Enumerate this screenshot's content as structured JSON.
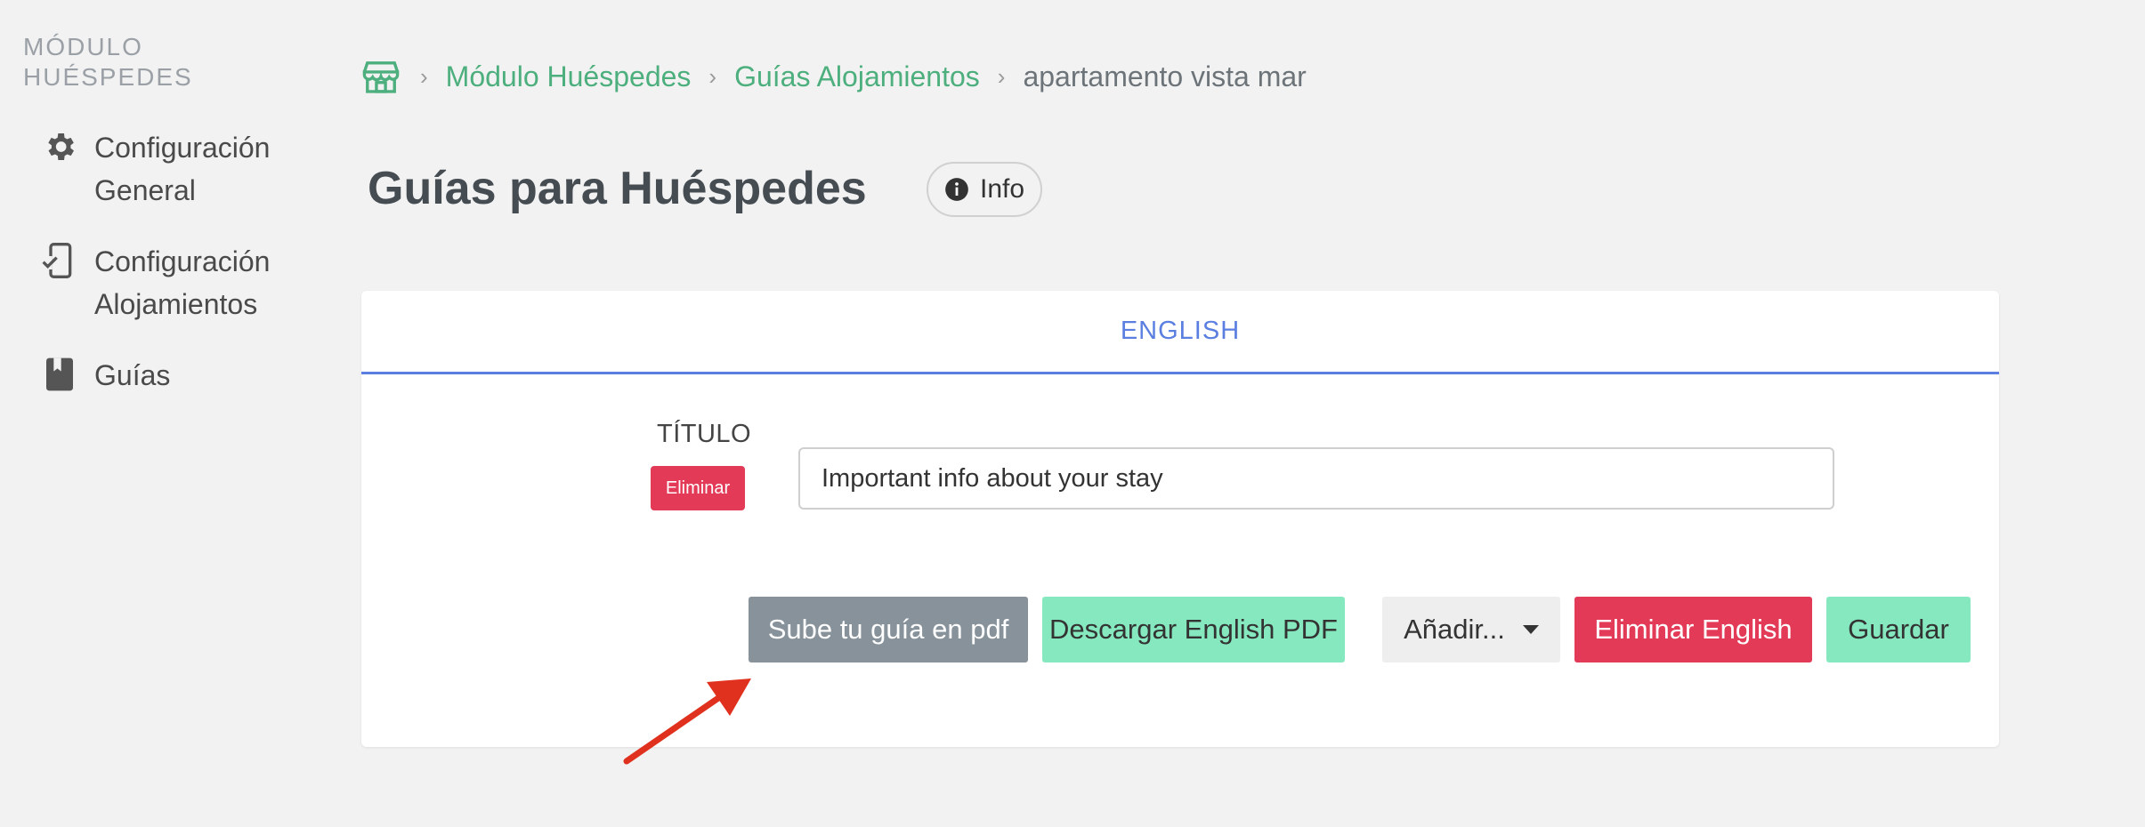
{
  "sidebar": {
    "heading": "MÓDULO HUÉSPEDES",
    "items": [
      {
        "label": "Configuración General",
        "icon": "gear-icon"
      },
      {
        "label": "Configuración Alojamientos",
        "icon": "device-check-icon"
      },
      {
        "label": "Guías",
        "icon": "book-icon"
      }
    ]
  },
  "breadcrumb": {
    "home_icon": "store-icon",
    "items": [
      "Módulo Huéspedes",
      "Guías Alojamientos"
    ],
    "current": "apartamento vista mar"
  },
  "page": {
    "title": "Guías para Huéspedes",
    "info_label": "Info"
  },
  "card": {
    "tab_label": "ENGLISH",
    "field_label": "TÍTULO",
    "delete_small_label": "Eliminar",
    "title_value": "Important info about your stay"
  },
  "actions": {
    "upload_label": "Sube tu guía en pdf",
    "download_label": "Descargar English PDF",
    "add_label": "Añadir...",
    "delete_label": "Eliminar English",
    "save_label": "Guardar"
  },
  "colors": {
    "accent_green": "#4caf7d",
    "tab_blue": "#5b7fe0",
    "danger": "#e23a57",
    "mint": "#86e8bf",
    "annotation_arrow": "#e0301e"
  }
}
